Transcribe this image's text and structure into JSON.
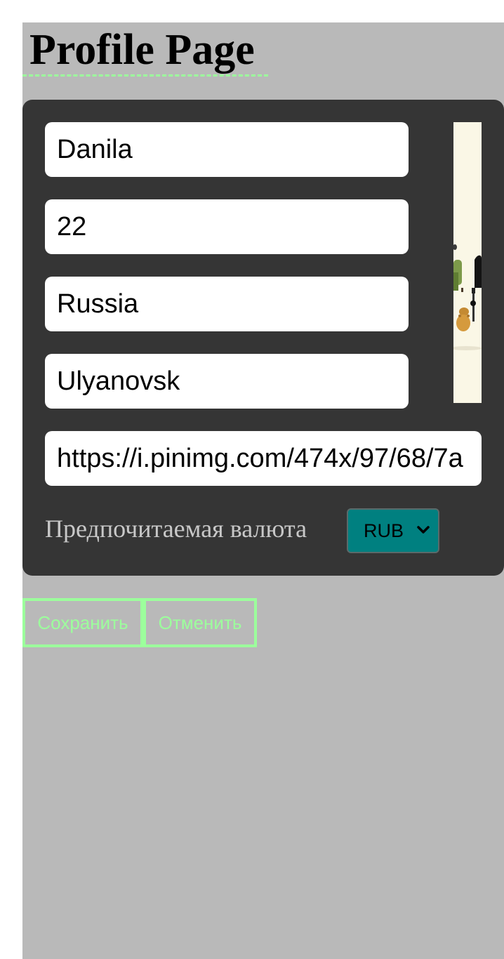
{
  "header": {
    "title": "Profile Page"
  },
  "profile_form": {
    "name_value": "Danila",
    "age_value": "22",
    "country_value": "Russia",
    "city_value": "Ulyanovsk",
    "avatar_url_value": "https://i.pinimg.com/474x/97/68/7a"
  },
  "currency": {
    "label": "Предпочитаемая валюта",
    "selected": "RUB"
  },
  "actions": {
    "save_label": "Сохранить",
    "cancel_label": "Отменить"
  },
  "colors": {
    "page_background": "#b9b9b9",
    "card_background": "#353535",
    "accent_green": "#9cff9c",
    "select_background": "#008080",
    "label_gray": "#c8c8c8"
  },
  "icons": {
    "select_arrow": "chevron-down-icon",
    "avatar": "avatar-preview-image"
  }
}
